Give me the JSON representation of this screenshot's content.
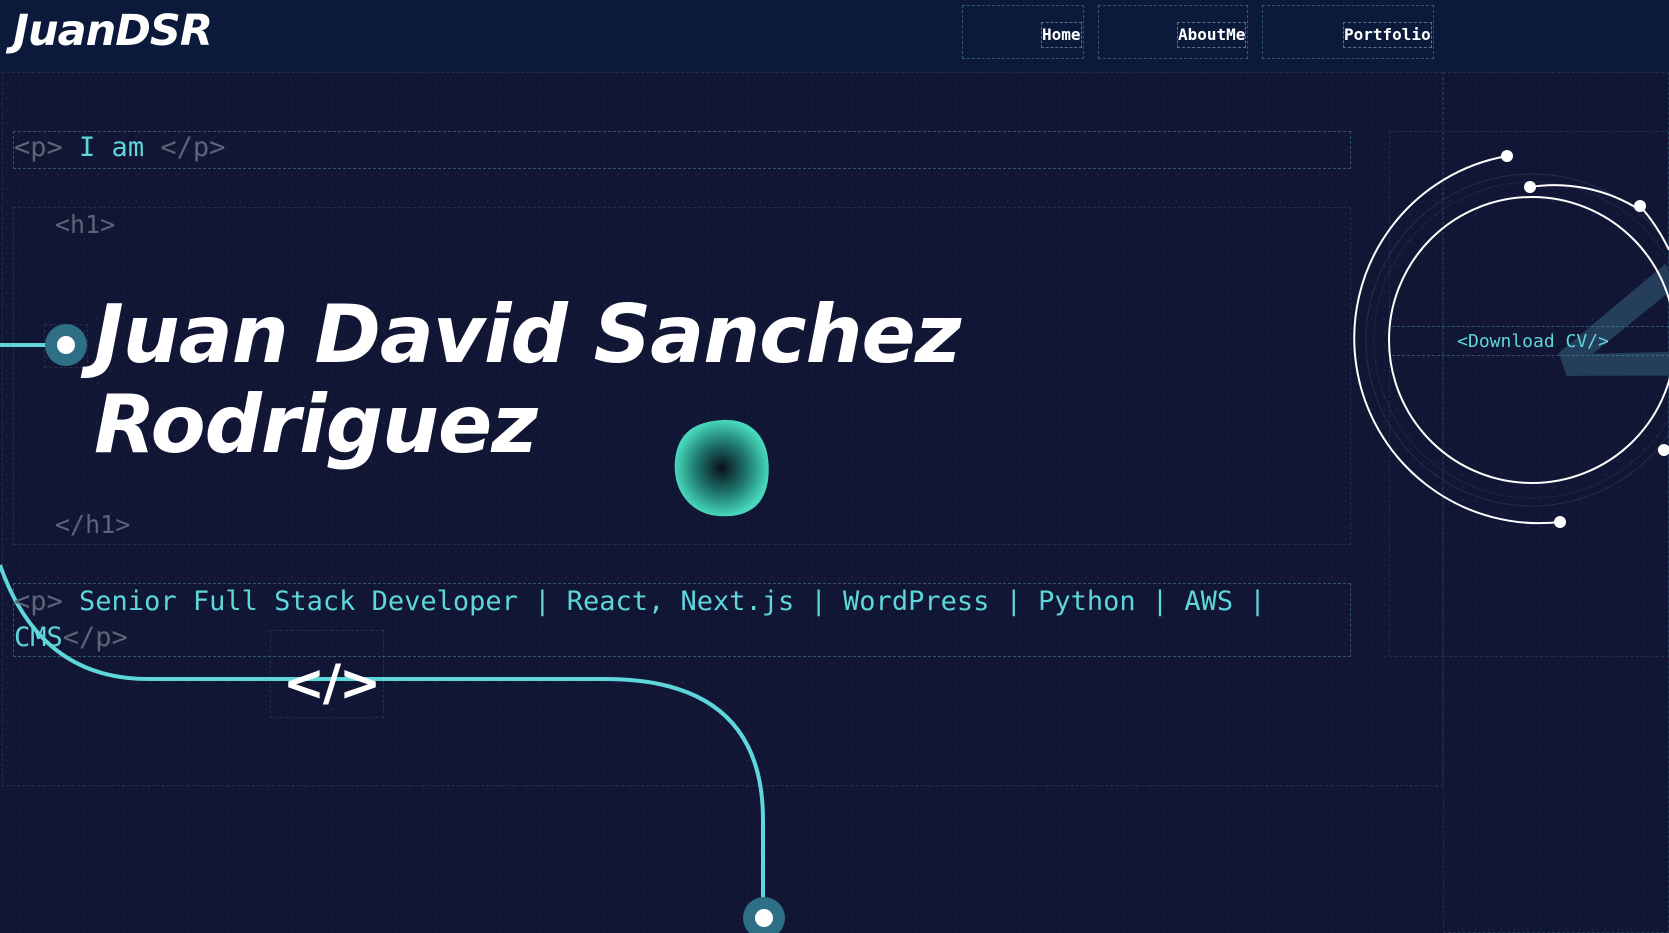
{
  "header": {
    "logo": "JuanDSR",
    "nav": [
      {
        "label": "Home"
      },
      {
        "label": "AboutMe"
      },
      {
        "label": "Portfolio"
      }
    ]
  },
  "hero": {
    "intro_open_tag": "<p>",
    "intro_text": "I am",
    "intro_close_tag": "</p>",
    "h1_open_tag": "<h1>",
    "h1_close_tag": "</h1>",
    "name_line1": "Juan David Sanchez",
    "name_line2": "Rodriguez",
    "tagline_open_tag": "<p>",
    "tagline_text": "Senior Full Stack Developer | React, Next.js | WordPress | Python | AWS | CMS",
    "tagline_close_tag": "</p>",
    "code_glyph": "</>"
  },
  "cv": {
    "download_label": "<Download CV/>",
    "watermark": "</>"
  },
  "colors": {
    "background": "#111634",
    "header": "#0b1a3b",
    "accent": "#5ed6dc",
    "tag_gray": "#5d6478"
  }
}
